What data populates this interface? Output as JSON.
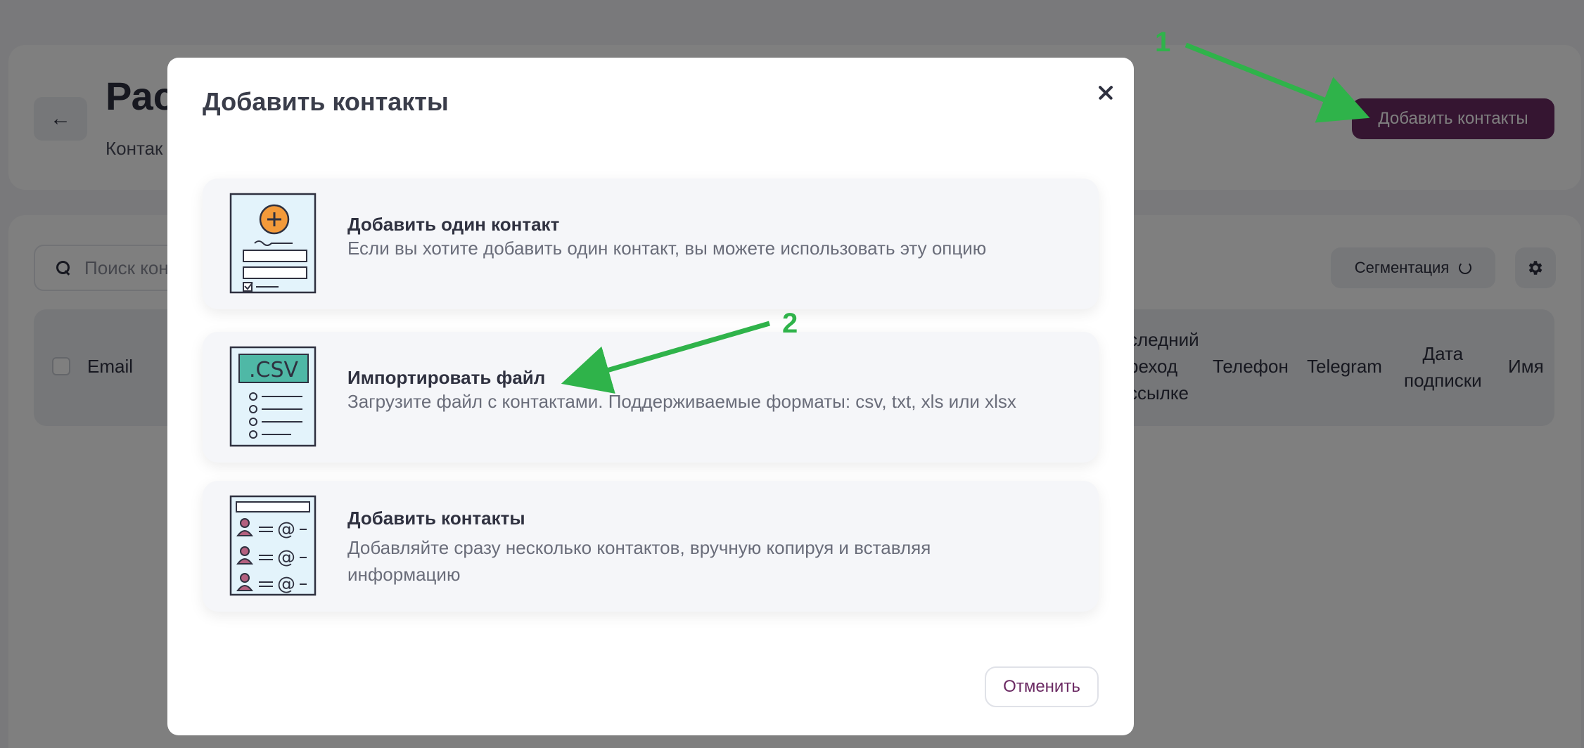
{
  "page": {
    "back_symbol": "←",
    "title": "Рас",
    "subtitle": "Контак",
    "add_contacts_button": "Добавить контакты",
    "search_placeholder": "Поиск кон",
    "segmentation_button": "Сегментация",
    "table_headers": {
      "email": "Email",
      "last_click": "последний\nпереход\nпо ссылке",
      "last_click_visible": "следний\nреход\nссылке",
      "phone": "Телефон",
      "telegram": "Telegram",
      "subscription_date": "Дата\nподписки",
      "name": "Имя"
    }
  },
  "modal": {
    "title": "Добавить контакты",
    "options": [
      {
        "title": "Добавить один контакт",
        "description": "Если вы хотите добавить один контакт, вы можете использовать эту опцию",
        "icon": "single-contact-form-icon"
      },
      {
        "title": "Импортировать файл",
        "description": "Загрузите файл с контактами. Поддерживаемые форматы: csv, txt, xls или xlsx",
        "icon": "csv-file-icon",
        "icon_text": ".CSV"
      },
      {
        "title": "Добавить контакты",
        "description": "Добавляйте сразу несколько контактов, вручную копируя и вставляя информацию",
        "icon": "contacts-list-icon"
      }
    ],
    "cancel_button": "Отменить"
  },
  "annotations": {
    "label_1": "1",
    "label_2": "2",
    "color": "#2fb34a"
  },
  "colors": {
    "brand": "#6b2a63",
    "overlay": "rgba(0,0,0,0.5)"
  }
}
